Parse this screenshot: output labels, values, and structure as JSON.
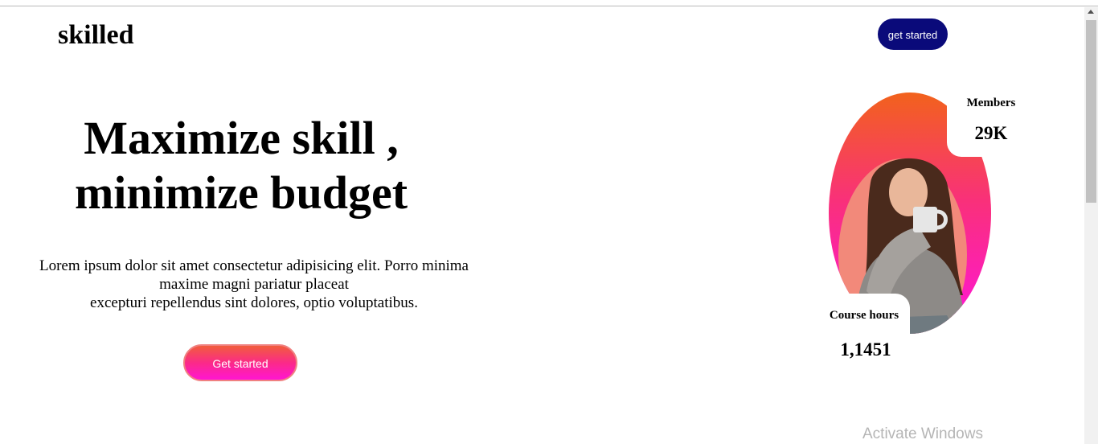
{
  "header": {
    "logo": "skilled",
    "cta_label": "get started"
  },
  "hero": {
    "title": "Maximize skill , minimize budget",
    "description_line1": "Lorem ipsum dolor sit amet consectetur adipisicing elit. Porro minima maxime magni pariatur placeat",
    "description_line2": "excepturi repellendus sint dolores, optio voluptatibus.",
    "button_label": "Get started"
  },
  "stats": {
    "members_label": "Members",
    "members_value": "29K",
    "hours_label": "Course hours",
    "hours_value": "1,1451"
  },
  "system": {
    "watermark": "Activate Windows"
  },
  "colors": {
    "nav_button": "#0a0a7a",
    "gradient_top": "#f2621c",
    "gradient_bottom": "#ff14dc"
  }
}
